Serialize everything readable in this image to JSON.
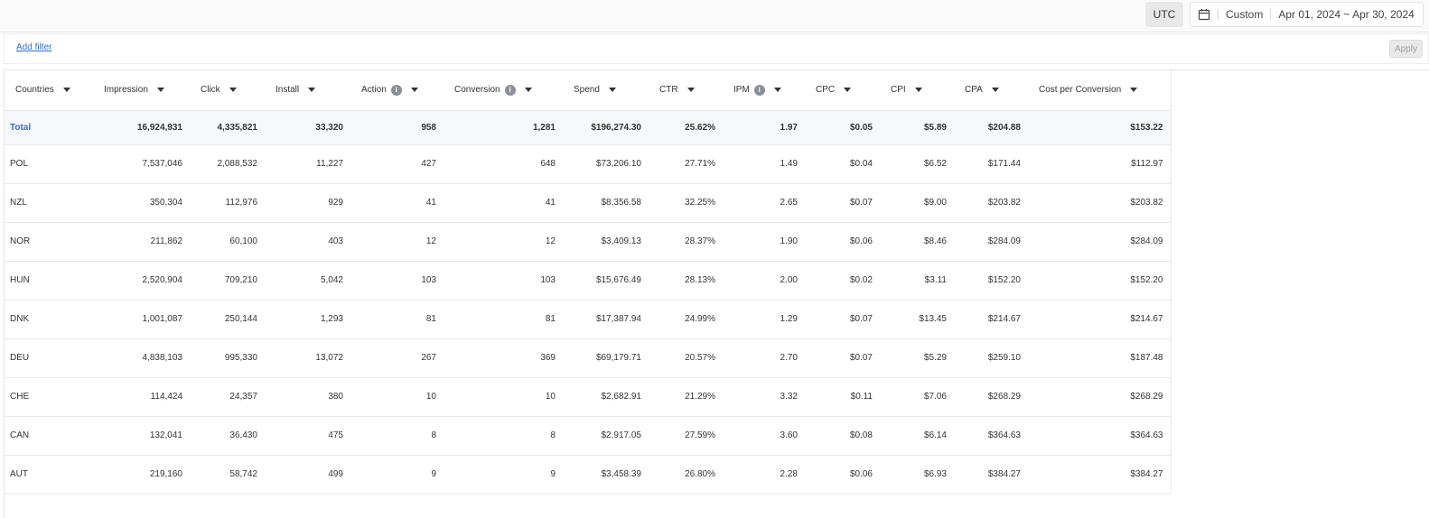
{
  "topbar": {
    "timezone": "UTC",
    "range_mode": "Custom",
    "date_range": "Apr 01, 2024 ~ Apr 30, 2024"
  },
  "filterbar": {
    "add_filter": "Add filter",
    "apply": "Apply"
  },
  "table": {
    "columns": [
      {
        "label": "Countries",
        "info": false
      },
      {
        "label": "Impression",
        "info": false
      },
      {
        "label": "Click",
        "info": false
      },
      {
        "label": "Install",
        "info": false
      },
      {
        "label": "Action",
        "info": true
      },
      {
        "label": "Conversion",
        "info": true
      },
      {
        "label": "Spend",
        "info": false
      },
      {
        "label": "CTR",
        "info": false
      },
      {
        "label": "IPM",
        "info": true
      },
      {
        "label": "CPC",
        "info": false
      },
      {
        "label": "CPI",
        "info": false
      },
      {
        "label": "CPA",
        "info": false
      },
      {
        "label": "Cost per Conversion",
        "info": false
      }
    ],
    "total": [
      "Total",
      "16,924,931",
      "4,335,821",
      "33,320",
      "958",
      "1,281",
      "$196,274.30",
      "25.62%",
      "1.97",
      "$0.05",
      "$5.89",
      "$204.88",
      "$153.22"
    ],
    "rows": [
      [
        "POL",
        "7,537,046",
        "2,088,532",
        "11,227",
        "427",
        "648",
        "$73,206.10",
        "27.71%",
        "1.49",
        "$0.04",
        "$6.52",
        "$171.44",
        "$112.97"
      ],
      [
        "NZL",
        "350,304",
        "112,976",
        "929",
        "41",
        "41",
        "$8,356.58",
        "32.25%",
        "2.65",
        "$0.07",
        "$9.00",
        "$203.82",
        "$203.82"
      ],
      [
        "NOR",
        "211,862",
        "60,100",
        "403",
        "12",
        "12",
        "$3,409.13",
        "28.37%",
        "1.90",
        "$0.06",
        "$8.46",
        "$284.09",
        "$284.09"
      ],
      [
        "HUN",
        "2,520,904",
        "709,210",
        "5,042",
        "103",
        "103",
        "$15,676.49",
        "28.13%",
        "2.00",
        "$0.02",
        "$3.11",
        "$152.20",
        "$152.20"
      ],
      [
        "DNK",
        "1,001,087",
        "250,144",
        "1,293",
        "81",
        "81",
        "$17,387.94",
        "24.99%",
        "1.29",
        "$0.07",
        "$13.45",
        "$214.67",
        "$214.67"
      ],
      [
        "DEU",
        "4,838,103",
        "995,330",
        "13,072",
        "267",
        "369",
        "$69,179.71",
        "20.57%",
        "2.70",
        "$0.07",
        "$5.29",
        "$259.10",
        "$187.48"
      ],
      [
        "CHE",
        "114,424",
        "24,357",
        "380",
        "10",
        "10",
        "$2,682.91",
        "21.29%",
        "3.32",
        "$0.11",
        "$7.06",
        "$268.29",
        "$268.29"
      ],
      [
        "CAN",
        "132,041",
        "36,430",
        "475",
        "8",
        "8",
        "$2,917.05",
        "27.59%",
        "3.60",
        "$0.08",
        "$6.14",
        "$364.63",
        "$364.63"
      ],
      [
        "AUT",
        "219,160",
        "58,742",
        "499",
        "9",
        "9",
        "$3,458.39",
        "26.80%",
        "2.28",
        "$0.06",
        "$6.93",
        "$384.27",
        "$384.27"
      ]
    ]
  }
}
